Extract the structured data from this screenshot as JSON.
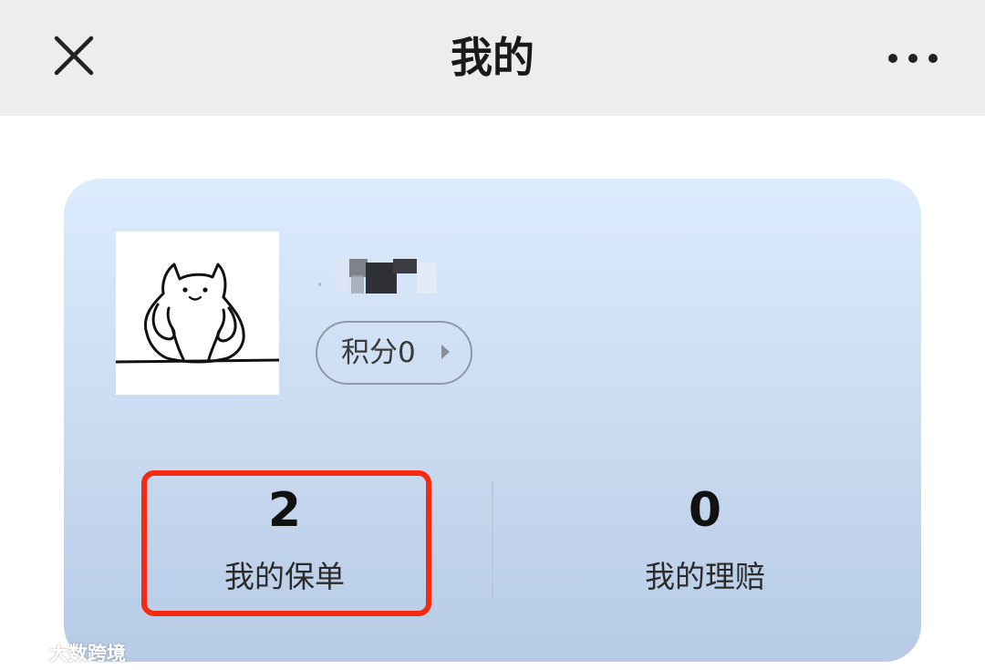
{
  "header": {
    "title": "我的",
    "close_icon": "close-icon",
    "more_icon": "more-icon"
  },
  "profile": {
    "avatar_icon": "cat-avatar-illustration",
    "username_blurred": true,
    "points_label": "积分0"
  },
  "stats": [
    {
      "value": "2",
      "label": "我的保单"
    },
    {
      "value": "0",
      "label": "我的理赔"
    }
  ],
  "colors": {
    "header_bg": "#ededed",
    "card_top": "#dbecfd",
    "card_bottom": "#b7cbe6",
    "highlight": "#f52a11"
  },
  "watermark": {
    "text": "大数跨境"
  }
}
